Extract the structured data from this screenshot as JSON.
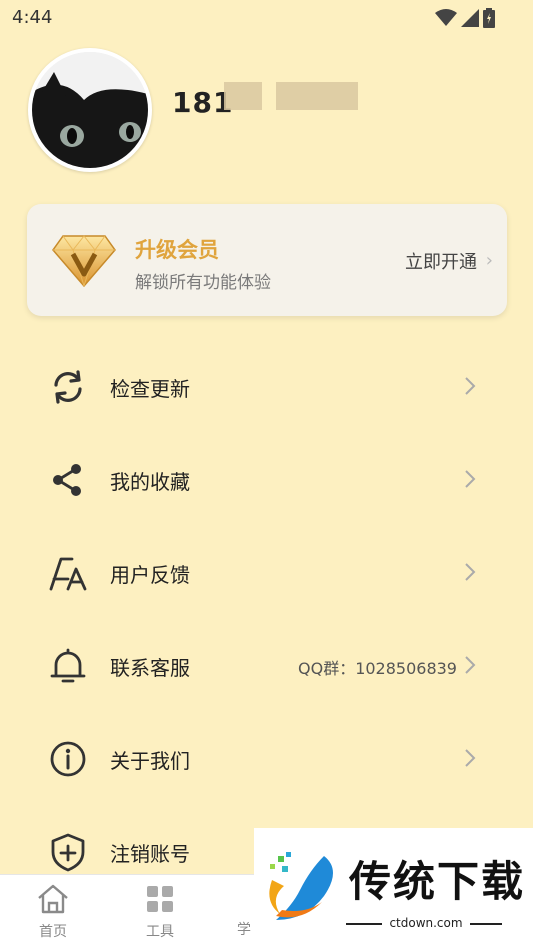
{
  "status": {
    "time": "4:44"
  },
  "profile": {
    "username": "181"
  },
  "vip": {
    "title": "升级会员",
    "subtitle": "解锁所有功能体验",
    "action": "立即开通",
    "colors": {
      "title": "#e0a43d"
    }
  },
  "menu": [
    {
      "label": "检查更新",
      "icon": "refresh-icon",
      "extra": ""
    },
    {
      "label": "我的收藏",
      "icon": "share-icon",
      "extra": ""
    },
    {
      "label": "用户反馈",
      "icon": "font-icon",
      "extra": ""
    },
    {
      "label": "联系客服",
      "icon": "bell-icon",
      "extra": "QQ群：1028506839"
    },
    {
      "label": "关于我们",
      "icon": "info-icon",
      "extra": ""
    },
    {
      "label": "注销账号",
      "icon": "shield-plus-icon",
      "extra": ""
    }
  ],
  "nav": [
    {
      "label": "首页",
      "icon": "home-icon"
    },
    {
      "label": "工具",
      "icon": "grid-icon"
    },
    {
      "label": "学",
      "icon": "learn-icon"
    }
  ],
  "watermark": {
    "title": "传统下载",
    "url": "ctdown.com"
  },
  "theme": {
    "background": "#fdf0c1",
    "card": "#f5f2ea"
  }
}
